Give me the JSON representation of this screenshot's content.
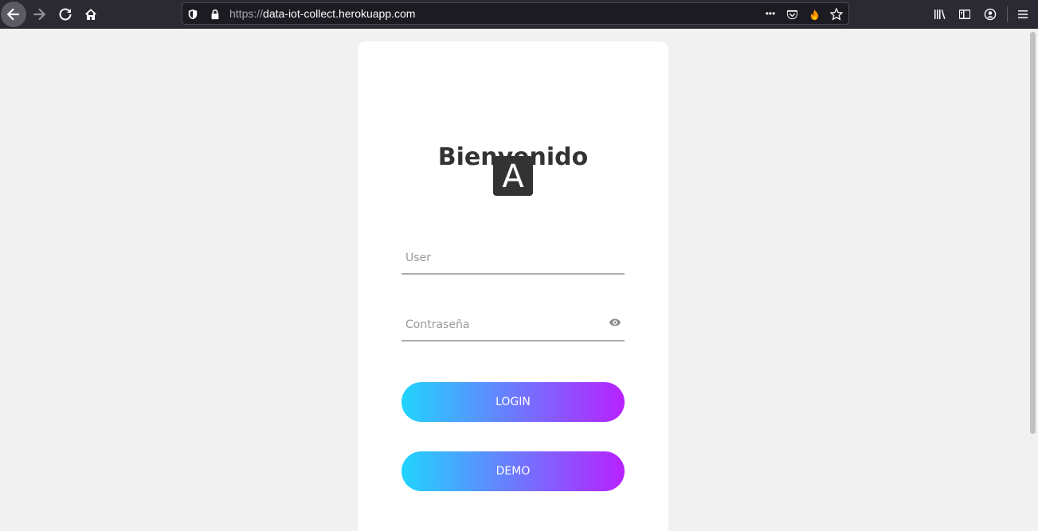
{
  "browser": {
    "url_scheme": "https://",
    "url_host": "data-iot-collect.herokuapp.com",
    "url_dots": "•••"
  },
  "login": {
    "title": "Bienvenido",
    "logo_letter": "A",
    "user_placeholder": "User",
    "password_placeholder": "Contraseña",
    "login_label": "LOGIN",
    "demo_label": "DEMO"
  },
  "colors": {
    "gradient_start": "#21d4fd",
    "gradient_end": "#b721ff",
    "page_bg": "#f1f1f1",
    "card_bg": "#ffffff"
  }
}
